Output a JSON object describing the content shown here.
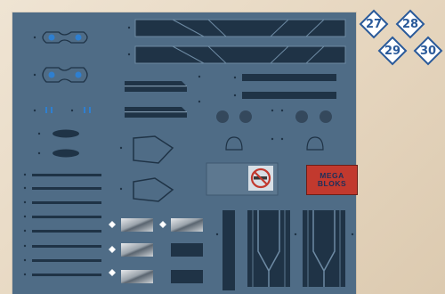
{
  "markers": [
    "27",
    "28",
    "29",
    "30"
  ],
  "brand_decal": {
    "line1": "MEGA",
    "line2": "BLOKS"
  },
  "colors": {
    "sheet": "#4f6c86",
    "decal_dark": "#1f3346",
    "marker_border": "#2a5a9a",
    "marker_fill": "#ffffff",
    "warning_red": "#c2392e"
  },
  "icons": [
    "no-smoking-icon"
  ]
}
